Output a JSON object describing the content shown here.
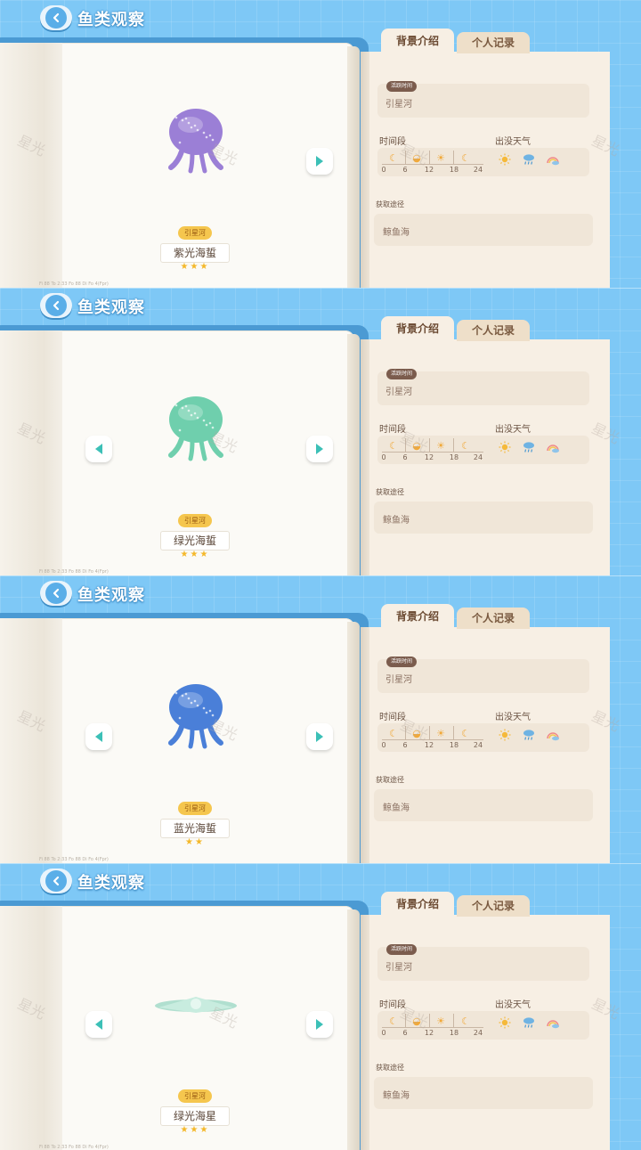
{
  "screen": {
    "title": "鱼类观察",
    "tabs": {
      "background": "背景介绍",
      "records": "个人记录"
    },
    "active_time_tag": "活跃时间",
    "time_label": "时间段",
    "weather_label": "出没天气",
    "acquire_label": "获取途径",
    "time_ticks": [
      "0",
      "6",
      "12",
      "18",
      "24"
    ],
    "footer": "Fi 88   To 2:33   Fo 88   Di Fo 4(Fpr)",
    "watermark": "星光"
  },
  "entries": [
    {
      "name": "紫光海蜇",
      "location_badge": "引星河",
      "active_location": "引星河",
      "acquire": "鲸鱼海",
      "stars": 3,
      "star_text": "★★★",
      "color": "#9b7fd6",
      "left_arrow": false
    },
    {
      "name": "绿光海蜇",
      "location_badge": "引星河",
      "active_location": "引星河",
      "acquire": "鲸鱼海",
      "stars": 3,
      "star_text": "★★★",
      "color": "#6fcfad",
      "left_arrow": true
    },
    {
      "name": "蓝光海蜇",
      "location_badge": "引星河",
      "active_location": "引星河",
      "acquire": "鲸鱼海",
      "stars": 2,
      "star_text": "★★",
      "color": "#4a7fd8",
      "left_arrow": true
    },
    {
      "name": "绿光海星",
      "location_badge": "引星河",
      "active_location": "引星河",
      "acquire": "鲸鱼海",
      "stars": 3,
      "star_text": "★★★",
      "color": "#a7dccb",
      "left_arrow": true
    }
  ],
  "colors": {
    "sky": "#7ec8f6",
    "accent_teal": "#3cc0b7",
    "badge": "#f5c64e",
    "star": "#f4b82a"
  }
}
